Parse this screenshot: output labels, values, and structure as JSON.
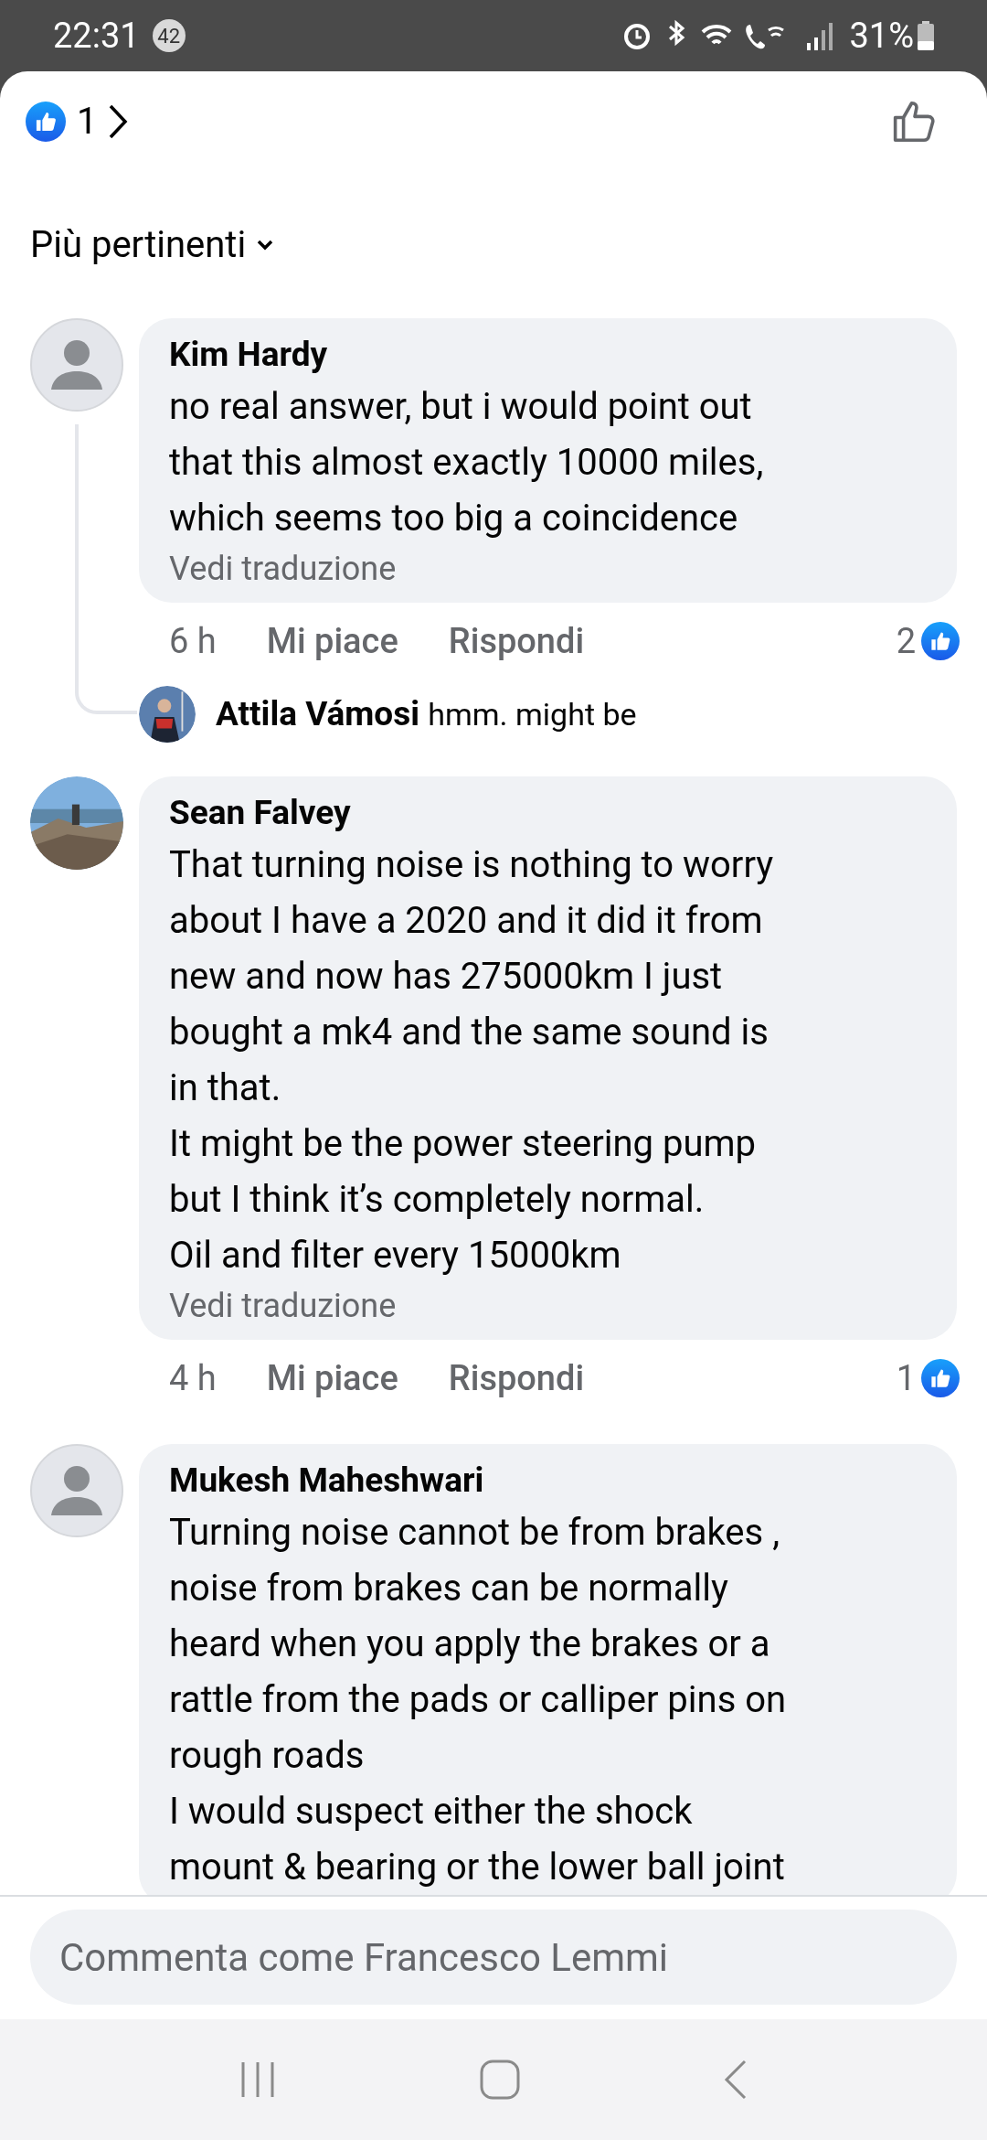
{
  "status_bar": {
    "time": "22:31",
    "notification_count": "42",
    "battery": "31%"
  },
  "header": {
    "reaction_count": "1"
  },
  "sort": {
    "label": "Più pertinenti"
  },
  "comments": [
    {
      "kind": "default",
      "name": "Kim Hardy",
      "lines": [
        "no real answer, but i would point out",
        "that this almost exactly 10000 miles,",
        "which seems too big a coincidence"
      ],
      "translate": "Vedi traduzione",
      "time": "6 h",
      "like_label": "Mi piace",
      "reply_label": "Rispondi",
      "reactions": "2",
      "replies": [
        {
          "name": "Attila Vámosi",
          "text": "hmm. might be"
        }
      ]
    },
    {
      "name": "Sean Falvey",
      "lines": [
        "That turning noise is nothing to worry",
        "about I have a 2020 and it did it from",
        "new and now has 275000km I just",
        "bought a mk4 and the same sound is",
        "in that.",
        "It might be the power steering pump",
        "but I think it’s completely normal.",
        "Oil and filter every 15000km"
      ],
      "translate": "Vedi traduzione",
      "time": "4 h",
      "like_label": "Mi piace",
      "reply_label": "Rispondi",
      "reactions": "1"
    },
    {
      "kind": "default",
      "name": "Mukesh Maheshwari",
      "lines": [
        "Turning noise cannot be from brakes ,",
        "noise from brakes can be normally",
        "heard when you apply the brakes or a",
        "rattle from the pads or calliper pins on",
        "rough roads",
        "I would suspect either the shock",
        "mount & bearing or the lower ball joint"
      ]
    }
  ],
  "composer": {
    "placeholder": "Commenta come Francesco Lemmi"
  }
}
